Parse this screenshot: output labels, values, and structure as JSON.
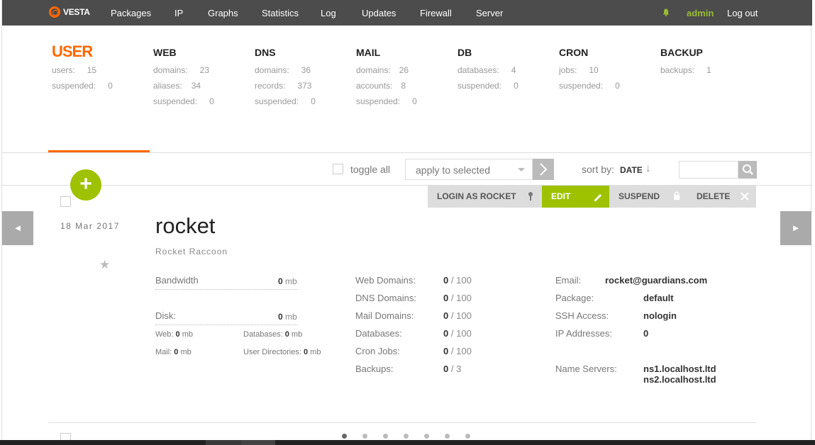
{
  "app": {
    "logo": "VESTA"
  },
  "nav": {
    "items": [
      "Packages",
      "IP",
      "Graphs",
      "Statistics",
      "Log",
      "Updates",
      "Firewall",
      "Server"
    ],
    "user": "admin",
    "logout": "Log out"
  },
  "stats": [
    {
      "title": "USER",
      "rows": [
        {
          "k": "users:",
          "v": "15"
        },
        {
          "k": "suspended:",
          "v": "0"
        }
      ]
    },
    {
      "title": "WEB",
      "rows": [
        {
          "k": "domains:",
          "v": "23"
        },
        {
          "k": "aliases:",
          "v": "34"
        },
        {
          "k": "suspended:",
          "v": "0"
        }
      ]
    },
    {
      "title": "DNS",
      "rows": [
        {
          "k": "domains:",
          "v": "36"
        },
        {
          "k": "records:",
          "v": "373"
        },
        {
          "k": "suspended:",
          "v": "0"
        }
      ]
    },
    {
      "title": "MAIL",
      "rows": [
        {
          "k": "domains:",
          "v": "26"
        },
        {
          "k": "accounts:",
          "v": "8"
        },
        {
          "k": "suspended:",
          "v": "0"
        }
      ]
    },
    {
      "title": "DB",
      "rows": [
        {
          "k": "databases:",
          "v": "4"
        },
        {
          "k": "suspended:",
          "v": "0"
        }
      ]
    },
    {
      "title": "CRON",
      "rows": [
        {
          "k": "jobs:",
          "v": "10"
        },
        {
          "k": "suspended:",
          "v": "0"
        }
      ]
    },
    {
      "title": "BACKUP",
      "rows": [
        {
          "k": "backups:",
          "v": "1"
        }
      ]
    }
  ],
  "toolbar": {
    "toggle_all": "toggle all",
    "apply": "apply to selected",
    "sort_label": "sort by:",
    "sort_value": "DATE",
    "sort_arrow": "↓"
  },
  "actions": {
    "login": "LOGIN AS ROCKET",
    "edit": "EDIT",
    "suspend": "SUSPEND",
    "delete": "DELETE"
  },
  "record": {
    "date": "18  Mar  2017",
    "username": "rocket",
    "fullname": "Rocket Raccoon",
    "bandwidth_label": "Bandwidth",
    "bandwidth_value": "0",
    "disk_label": "Disk:",
    "disk_value": "0",
    "unit": "mb",
    "disk_web_label": "Web:",
    "disk_web": "0",
    "disk_db_label": "Databases:",
    "disk_db": "0",
    "disk_mail_label": "Mail:",
    "disk_mail": "0",
    "disk_udir_label": "User Directories:",
    "disk_udir": "0",
    "limits": [
      {
        "k": "Web Domains:",
        "used": "0",
        "max": "100"
      },
      {
        "k": "DNS Domains:",
        "used": "0",
        "max": "100"
      },
      {
        "k": "Mail Domains:",
        "used": "0",
        "max": "100"
      },
      {
        "k": "Databases:",
        "used": "0",
        "max": "100"
      },
      {
        "k": "Cron Jobs:",
        "used": "0",
        "max": "100"
      },
      {
        "k": "Backups:",
        "used": "0",
        "max": "3"
      }
    ],
    "info": {
      "email_label": "Email:",
      "email": "rocket@guardians.com",
      "package_label": "Package:",
      "package": "default",
      "ssh_label": "SSH Access:",
      "ssh": "nologin",
      "ip_label": "IP Addresses:",
      "ip": "0",
      "ns_label": "Name Servers:",
      "ns1": "ns1.localhost.ltd",
      "ns2": "ns2.localhost.ltd"
    }
  },
  "pagination": {
    "pages": 7,
    "current": 1
  },
  "colors": {
    "accent": "#ff6701",
    "green": "#9ec200",
    "topbar": "#4c4c4c"
  }
}
